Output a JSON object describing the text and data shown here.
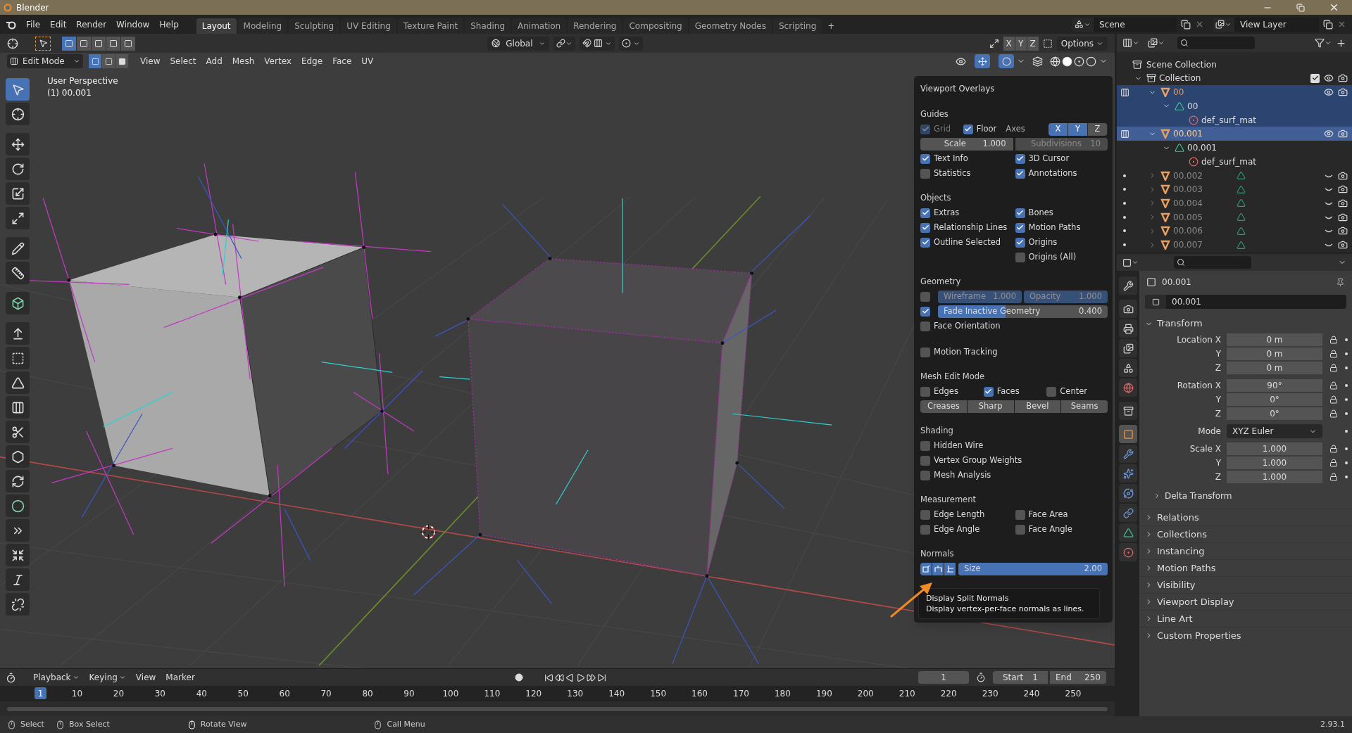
{
  "window": {
    "title": "Blender"
  },
  "menu": [
    "File",
    "Edit",
    "Render",
    "Window",
    "Help"
  ],
  "workspaces": [
    {
      "label": "Layout",
      "selected": true
    },
    {
      "label": "Modeling",
      "selected": false
    },
    {
      "label": "Sculpting",
      "selected": false
    },
    {
      "label": "UV Editing",
      "selected": false
    },
    {
      "label": "Texture Paint",
      "selected": false
    },
    {
      "label": "Shading",
      "selected": false
    },
    {
      "label": "Animation",
      "selected": false
    },
    {
      "label": "Rendering",
      "selected": false
    },
    {
      "label": "Compositing",
      "selected": false
    },
    {
      "label": "Geometry Nodes",
      "selected": false
    },
    {
      "label": "Scripting",
      "selected": false
    }
  ],
  "add_workspace": "+",
  "scene": "Scene",
  "view_layer": "View Layer",
  "tool_header": {
    "orientation": "Global",
    "mirror": [
      {
        "label": "X",
        "on": false
      },
      {
        "label": "Y",
        "on": false
      },
      {
        "label": "Z",
        "on": false
      }
    ],
    "options": "Options"
  },
  "view_header": {
    "mode": "Edit Mode",
    "select_modes": [
      {
        "kind": "vertex",
        "selected": true
      },
      {
        "kind": "edge",
        "selected": false
      },
      {
        "kind": "face",
        "selected": false
      }
    ],
    "menus": [
      "View",
      "Select",
      "Add",
      "Mesh",
      "Vertex",
      "Edge",
      "Face",
      "UV"
    ]
  },
  "viewport": {
    "perspective": "User Perspective",
    "object_info": "(1) 00.001",
    "tools": [
      {
        "kind": "select",
        "selected": true
      },
      {
        "kind": "cursor",
        "selected": false
      },
      {
        "kind": "move",
        "selected": false
      },
      {
        "kind": "rotate",
        "selected": false
      },
      {
        "kind": "scale",
        "selected": false
      },
      {
        "kind": "transform",
        "selected": false
      },
      {
        "kind": "annotate",
        "selected": false
      },
      {
        "kind": "measure",
        "selected": false
      },
      {
        "kind": "add_cube",
        "selected": false
      },
      {
        "kind": "extrude",
        "selected": false
      },
      {
        "kind": "inset",
        "selected": false
      },
      {
        "kind": "bevel",
        "selected": false
      },
      {
        "kind": "loop_cut",
        "selected": false
      },
      {
        "kind": "knife",
        "selected": false
      },
      {
        "kind": "poly_build",
        "selected": false
      },
      {
        "kind": "spin",
        "selected": false
      },
      {
        "kind": "smooth",
        "selected": false
      },
      {
        "kind": "edge_slide",
        "selected": false
      },
      {
        "kind": "shrink",
        "selected": false
      },
      {
        "kind": "shear",
        "selected": false
      },
      {
        "kind": "rip",
        "selected": false
      }
    ]
  },
  "overlays": {
    "title": "Viewport Overlays",
    "sections": [
      {
        "title": "Guides",
        "rows": [
          {
            "cells": [
              {
                "kind": "check",
                "label": "Grid",
                "checked": true,
                "disabled": true
              },
              {
                "kind": "check",
                "label": "Floor",
                "checked": true,
                "disabled": false
              },
              {
                "kind": "text",
                "label": "Axes"
              },
              {
                "kind": "toggles",
                "items": [
                  {
                    "label": "X",
                    "on": true
                  },
                  {
                    "label": "Y",
                    "on": true
                  },
                  {
                    "label": "Z",
                    "on": false
                  }
                ]
              }
            ]
          },
          {
            "cells": [
              {
                "kind": "field",
                "label": "Scale",
                "value": "1.000",
                "disabled": false
              },
              {
                "kind": "field",
                "label": "Subdivisions",
                "value": "10",
                "disabled": true
              }
            ]
          },
          {
            "cells": [
              {
                "kind": "check",
                "label": "Text Info",
                "checked": true,
                "disabled": false
              },
              {
                "kind": "check",
                "label": "3D Cursor",
                "checked": true,
                "disabled": false
              }
            ]
          },
          {
            "cells": [
              {
                "kind": "check",
                "label": "Statistics",
                "checked": false,
                "disabled": false
              },
              {
                "kind": "check",
                "label": "Annotations",
                "checked": true,
                "disabled": false
              }
            ]
          }
        ]
      },
      {
        "title": "Objects",
        "rows": [
          {
            "cells": [
              {
                "kind": "check",
                "label": "Extras",
                "checked": true,
                "disabled": false
              },
              {
                "kind": "check",
                "label": "Bones",
                "checked": true,
                "disabled": false
              }
            ]
          },
          {
            "cells": [
              {
                "kind": "check",
                "label": "Relationship Lines",
                "checked": true,
                "disabled": false
              },
              {
                "kind": "check",
                "label": "Motion Paths",
                "checked": true,
                "disabled": false
              }
            ]
          },
          {
            "cells": [
              {
                "kind": "check",
                "label": "Outline Selected",
                "checked": true,
                "disabled": false
              },
              {
                "kind": "check",
                "label": "Origins",
                "checked": true,
                "disabled": false
              }
            ]
          },
          {
            "cells": [
              {
                "kind": "blank"
              },
              {
                "kind": "check",
                "label": "Origins (All)",
                "checked": false,
                "disabled": false
              }
            ]
          }
        ]
      },
      {
        "title": "Geometry",
        "rows": [
          {
            "cells": [
              {
                "kind": "check",
                "checked": false,
                "disabled": false
              },
              {
                "kind": "slider",
                "label": "Wireframe",
                "value": "1.000",
                "level": 1,
                "disabled": true
              },
              {
                "kind": "slider",
                "label": "Opacity",
                "value": "1.000",
                "level": 1,
                "disabled": true
              }
            ]
          },
          {
            "cells": [
              {
                "kind": "check",
                "checked": true,
                "disabled": false
              },
              {
                "kind": "slider",
                "label": "Fade Inactive Geometry",
                "value": "0.400",
                "level": 0.4,
                "disabled": false
              }
            ]
          },
          {
            "cells": [
              {
                "kind": "check",
                "label": "Face Orientation",
                "checked": false,
                "disabled": false
              }
            ]
          }
        ]
      },
      {
        "rows": [
          {
            "cells": [
              {
                "kind": "check",
                "label": "Motion Tracking",
                "checked": false,
                "disabled": false
              }
            ]
          }
        ]
      },
      {
        "title": "Mesh Edit Mode",
        "rows": [
          {
            "cells": [
              {
                "kind": "check",
                "label": "Edges",
                "checked": false,
                "disabled": false
              },
              {
                "kind": "check",
                "label": "Faces",
                "checked": true,
                "disabled": false
              },
              {
                "kind": "check",
                "label": "Center",
                "checked": false,
                "disabled": false
              }
            ]
          },
          {
            "cells": [
              {
                "kind": "buttons",
                "items": [
                  "Creases",
                  "Sharp",
                  "Bevel",
                  "Seams"
                ]
              }
            ]
          }
        ]
      },
      {
        "title": "Shading",
        "rows": [
          {
            "cells": [
              {
                "kind": "check",
                "label": "Hidden Wire",
                "checked": false,
                "disabled": false
              }
            ]
          },
          {
            "cells": [
              {
                "kind": "check",
                "label": "Vertex Group Weights",
                "checked": false,
                "disabled": false
              }
            ]
          },
          {
            "cells": [
              {
                "kind": "check",
                "label": "Mesh Analysis",
                "checked": false,
                "disabled": false
              }
            ]
          }
        ]
      },
      {
        "title": "Measurement",
        "rows": [
          {
            "cells": [
              {
                "kind": "check",
                "label": "Edge Length",
                "checked": false,
                "disabled": false
              },
              {
                "kind": "check",
                "label": "Face Area",
                "checked": false,
                "disabled": false
              }
            ]
          },
          {
            "cells": [
              {
                "kind": "check",
                "label": "Edge Angle",
                "checked": false,
                "disabled": false
              },
              {
                "kind": "check",
                "label": "Face Angle",
                "checked": false,
                "disabled": false
              }
            ]
          }
        ]
      },
      {
        "title": "Normals",
        "rows": [
          {
            "cells": [
              {
                "kind": "icon_toggles",
                "items": [
                  {
                    "kind": "vertex",
                    "on": true
                  },
                  {
                    "kind": "split",
                    "on": true
                  },
                  {
                    "kind": "face",
                    "on": true
                  }
                ]
              },
              {
                "kind": "slider",
                "label": "Size",
                "value": "2.00",
                "level": 1,
                "disabled": false
              }
            ]
          }
        ]
      }
    ]
  },
  "tooltip": {
    "title": "Display Split Normals",
    "text": "Display vertex-per-face normals as lines."
  },
  "outliner": {
    "root": "Scene Collection",
    "items": [
      {
        "name": "Collection",
        "kind": "collection",
        "expanded": true,
        "checked": true,
        "children": [
          {
            "name": "00",
            "kind": "object",
            "expanded": true,
            "selected": true,
            "active": false,
            "editing": true,
            "visible": true,
            "children": [
              {
                "name": "00",
                "kind": "mesh",
                "expanded": true,
                "selected": true,
                "children": [
                  {
                    "name": "def_surf_mat",
                    "kind": "material",
                    "selected": true
                  }
                ]
              }
            ]
          },
          {
            "name": "00.001",
            "kind": "object",
            "expanded": true,
            "selected": true,
            "active": true,
            "editing": true,
            "visible": true,
            "children": [
              {
                "name": "00.001",
                "kind": "mesh",
                "expanded": true,
                "selected": false,
                "children": [
                  {
                    "name": "def_surf_mat",
                    "kind": "material",
                    "selected": false
                  }
                ]
              }
            ]
          },
          {
            "name": "00.002",
            "kind": "object",
            "expanded": false,
            "selected": false,
            "active": false,
            "editing": false,
            "visible": false
          },
          {
            "name": "00.003",
            "kind": "object",
            "expanded": false,
            "selected": false,
            "active": false,
            "editing": false,
            "visible": false
          },
          {
            "name": "00.004",
            "kind": "object",
            "expanded": false,
            "selected": false,
            "active": false,
            "editing": false,
            "visible": false
          },
          {
            "name": "00.005",
            "kind": "object",
            "expanded": false,
            "selected": false,
            "active": false,
            "editing": false,
            "visible": false
          },
          {
            "name": "00.006",
            "kind": "object",
            "expanded": false,
            "selected": false,
            "active": false,
            "editing": false,
            "visible": false
          },
          {
            "name": "00.007",
            "kind": "object",
            "expanded": false,
            "selected": false,
            "active": false,
            "editing": false,
            "visible": false
          }
        ]
      }
    ]
  },
  "properties": {
    "tabs": [
      {
        "kind": "tool",
        "selected": false
      },
      {
        "kind": "render",
        "selected": false
      },
      {
        "kind": "output",
        "selected": false
      },
      {
        "kind": "view_layer",
        "selected": false
      },
      {
        "kind": "scene",
        "selected": false
      },
      {
        "kind": "world",
        "selected": false
      },
      {
        "kind": "collection",
        "selected": false
      },
      {
        "kind": "object",
        "selected": true
      },
      {
        "kind": "modifiers",
        "selected": false
      },
      {
        "kind": "particles",
        "selected": false
      },
      {
        "kind": "physics",
        "selected": false
      },
      {
        "kind": "constraints",
        "selected": false
      },
      {
        "kind": "data",
        "selected": false
      },
      {
        "kind": "material",
        "selected": false
      }
    ],
    "object_name": "00.001",
    "data_name": "00.001",
    "transform": {
      "title": "Transform",
      "expanded": true,
      "groups": [
        {
          "kind": "fields",
          "rows": [
            {
              "label": "Location X",
              "value": "0 m"
            },
            {
              "label": "Y",
              "value": "0 m"
            },
            {
              "label": "Z",
              "value": "0 m"
            }
          ]
        },
        {
          "kind": "fields",
          "rows": [
            {
              "label": "Rotation X",
              "value": "90°"
            },
            {
              "label": "Y",
              "value": "0°"
            },
            {
              "label": "Z",
              "value": "0°"
            }
          ]
        },
        {
          "kind": "dropdown",
          "label": "Mode",
          "value": "XYZ Euler"
        },
        {
          "kind": "fields",
          "rows": [
            {
              "label": "Scale X",
              "value": "1.000"
            },
            {
              "label": "Y",
              "value": "1.000"
            },
            {
              "label": "Z",
              "value": "1.000"
            }
          ]
        }
      ],
      "subpanels": [
        {
          "label": "Delta Transform",
          "expanded": false
        }
      ]
    },
    "panels": [
      {
        "label": "Relations",
        "expanded": false
      },
      {
        "label": "Collections",
        "expanded": false
      },
      {
        "label": "Instancing",
        "expanded": false
      },
      {
        "label": "Motion Paths",
        "expanded": false
      },
      {
        "label": "Visibility",
        "expanded": false
      },
      {
        "label": "Viewport Display",
        "expanded": false
      },
      {
        "label": "Line Art",
        "expanded": false
      },
      {
        "label": "Custom Properties",
        "expanded": false
      }
    ]
  },
  "timeline": {
    "menus": [
      "Playback",
      "Keying",
      "View",
      "Marker"
    ],
    "current_frame": "1",
    "start_label": "Start",
    "start": "1",
    "end_label": "End",
    "end": "250",
    "playhead": "1",
    "ruler": [
      "10",
      "20",
      "30",
      "40",
      "50",
      "60",
      "70",
      "80",
      "90",
      "100",
      "110",
      "120",
      "130",
      "140",
      "150",
      "160",
      "170",
      "180",
      "190",
      "200",
      "210",
      "220",
      "230",
      "240",
      "250"
    ]
  },
  "status_bar": {
    "items": [
      {
        "kind": "mouse_left",
        "label": "Select"
      },
      {
        "kind": "mouse_drag",
        "label": "Box Select"
      },
      {
        "kind": "mouse_middle",
        "label": "Rotate View"
      },
      {
        "kind": "mouse_right",
        "label": "Call Menu"
      }
    ],
    "version": "2.93.1"
  }
}
